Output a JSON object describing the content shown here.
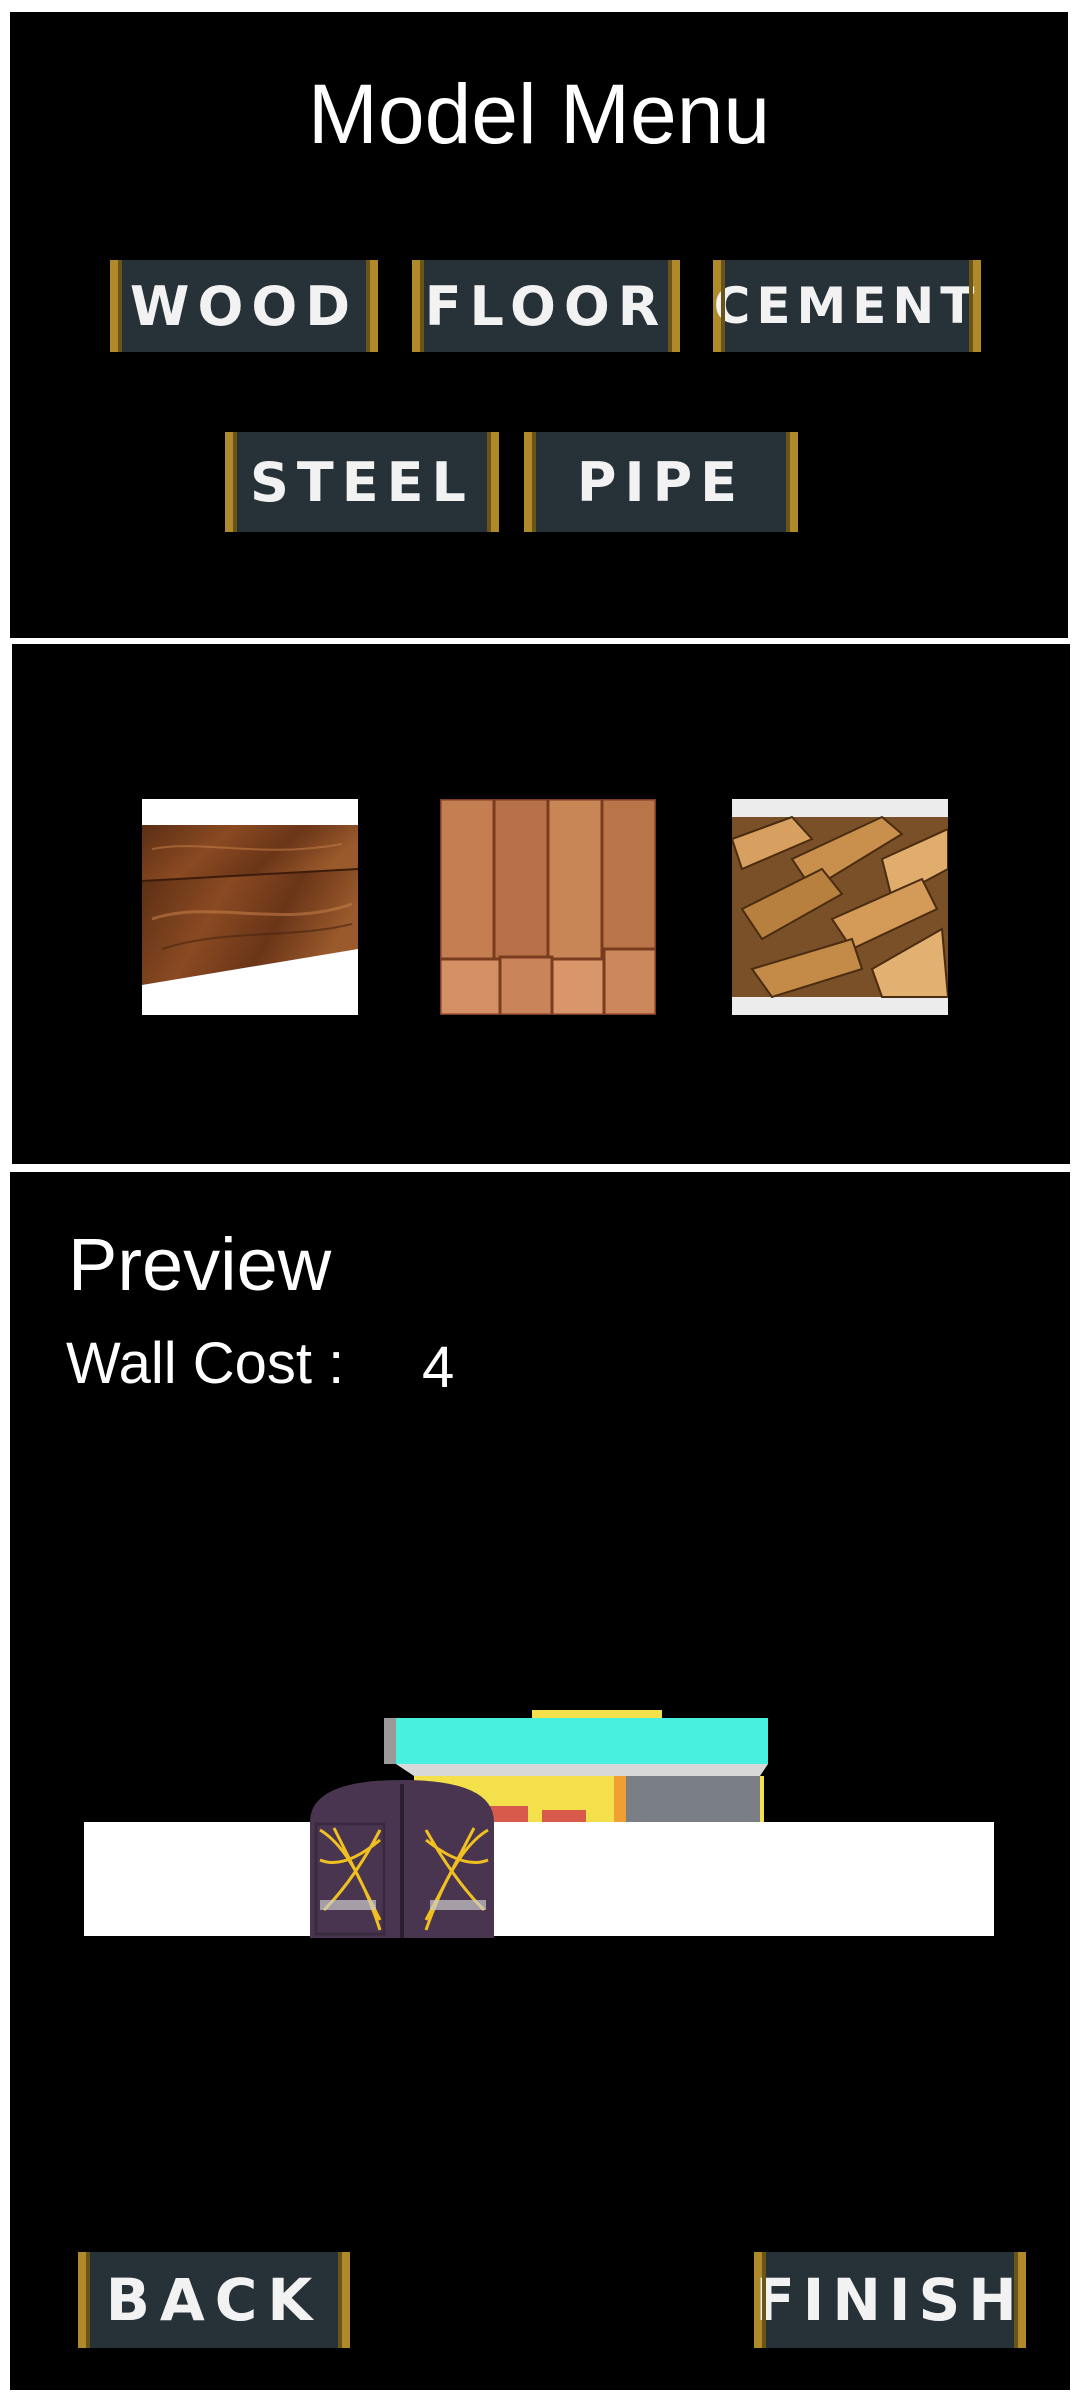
{
  "menu": {
    "title": "Model Menu",
    "buttons": [
      "WOOD",
      "FLOOR",
      "CEMENT",
      "STEEL",
      "PIPE"
    ]
  },
  "samples": {
    "items": [
      "wood-plank-sample",
      "wood-beam-stack-sample",
      "wood-offcut-pile-sample"
    ]
  },
  "preview": {
    "title": "Preview",
    "cost_label": "Wall Cost :",
    "cost_value": "4"
  },
  "footer": {
    "back_label": "BACK",
    "finish_label": "FINISH"
  },
  "colors": {
    "button_bg": "#263238",
    "button_trim": "#b08a2a",
    "panel_bg": "#000000",
    "roof": "#48f0e0",
    "house_wall": "#f4e04a",
    "gate": "#4a3550"
  }
}
